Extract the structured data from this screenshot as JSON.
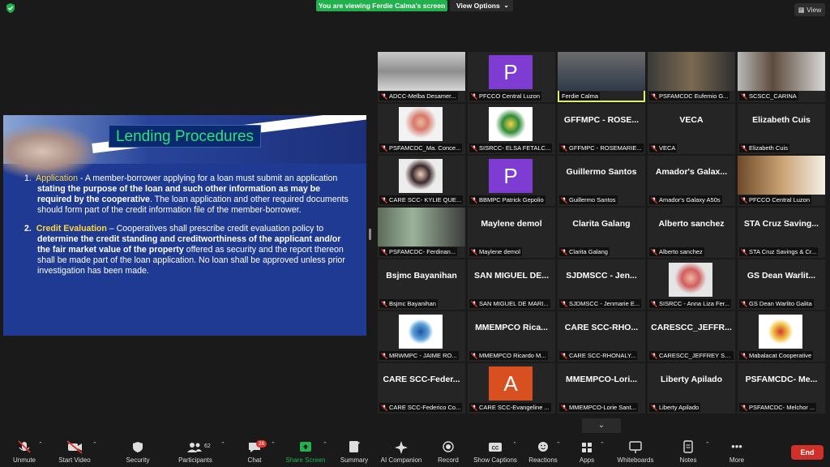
{
  "top": {
    "banner": "You are viewing Ferdie Calma's screen",
    "view_options": "View Options",
    "view": "View"
  },
  "slide": {
    "title": "Lending Procedures",
    "item1_num": "1.",
    "item1_kw": "Application",
    "item1_a": " - A member-borrower applying for a loan must submit an application ",
    "item1_b": "stating the purpose of the loan and such other information as may be required by the cooperative",
    "item1_c": ".  The loan application and other required documents should form part of the credit information file of the member-borrower.",
    "item2_num": "2.",
    "item2_kw": "Credit Evaluation",
    "item2_a": " – Cooperatives shall prescribe credit evaluation policy to ",
    "item2_b": "determine the credit standing and creditworthiness of the applicant and/or the fair market value of the property",
    "item2_c": " offered as security and the report thereon shall be made part of the loan application.  No loan shall be approved unless prior investigation has been made."
  },
  "tiles": [
    {
      "name": "ADCC-Melba Desamer...",
      "big": ""
    },
    {
      "name": "PFCCO Central Luzon",
      "big": "",
      "avatar": "P"
    },
    {
      "name": "Ferdie Calma",
      "big": ""
    },
    {
      "name": "PSFAMCDC Eufemio G...",
      "big": ""
    },
    {
      "name": "SCSCC_CARINA",
      "big": ""
    },
    {
      "name": "PSFAMCDC_Ma. Conce...",
      "big": ""
    },
    {
      "name": "SISRCC- ELSA FETALC...",
      "big": ""
    },
    {
      "name": "GFFMPC - ROSEMARIE...",
      "big": "GFFMPC - ROSE..."
    },
    {
      "name": "VECA",
      "big": "VECA"
    },
    {
      "name": "Elizabeth Cuis",
      "big": "Elizabeth Cuis"
    },
    {
      "name": "CARE SCC- KYLIE QUE...",
      "big": ""
    },
    {
      "name": "BBMPC Patrick Gepolio",
      "big": "",
      "avatar": "P"
    },
    {
      "name": "Guillermo Santos",
      "big": "Guillermo Santos"
    },
    {
      "name": "Amador's Galaxy A50s",
      "big": "Amador's Galax..."
    },
    {
      "name": "PFCCO Central Luzon",
      "big": ""
    },
    {
      "name": "PSFAMCDC- Ferdinan...",
      "big": ""
    },
    {
      "name": "Maylene demol",
      "big": "Maylene demol"
    },
    {
      "name": "Clarita Galang",
      "big": "Clarita Galang"
    },
    {
      "name": "Alberto sanchez",
      "big": "Alberto sanchez"
    },
    {
      "name": "STA Cruz Savings & Cr...",
      "big": "STA Cruz Saving..."
    },
    {
      "name": "Bsjmc Bayanihan",
      "big": "Bsjmc Bayanihan"
    },
    {
      "name": "SAN MIGUEL DE MARI...",
      "big": "SAN MIGUEL DE..."
    },
    {
      "name": "SJDMSCC - Jenmarie E...",
      "big": "SJDMSCC - Jen..."
    },
    {
      "name": "SISRCC - Anna Liza Fer...",
      "big": ""
    },
    {
      "name": "GS Dean Warlito Galita",
      "big": "GS Dean Warlit..."
    },
    {
      "name": "MRWMPC - JAIME RO...",
      "big": ""
    },
    {
      "name": "MMEMPCO Ricardo M...",
      "big": "MMEMPCO Rica..."
    },
    {
      "name": "CARE SCC-RHONALY...",
      "big": "CARE SCC-RHO..."
    },
    {
      "name": "CARESCC_JEFFREY SA...",
      "big": "CARESCC_JEFFR..."
    },
    {
      "name": "Mabalacat Cooperative",
      "big": ""
    },
    {
      "name": "CARE SCC-Federico Co...",
      "big": "CARE SCC-Feder..."
    },
    {
      "name": "CARE SCC-Evangeline ...",
      "big": "",
      "avatar": "A"
    },
    {
      "name": "MMEMPCO-Lorie Sant...",
      "big": "MMEMPCO-Lori..."
    },
    {
      "name": "Liberty Apilado",
      "big": "Liberty Apilado"
    },
    {
      "name": "PSFAMCDC- Melchor ...",
      "big": "PSFAMCDC- Me..."
    }
  ],
  "toolbar": {
    "unmute": "Unmute",
    "start_video": "Start Video",
    "security": "Security",
    "participants": "Participants",
    "participants_count": "62",
    "chat": "Chat",
    "chat_badge": "26",
    "share_screen": "Share Screen",
    "summary": "Summary",
    "ai_companion": "AI Companion",
    "record": "Record",
    "show_captions": "Show Captions",
    "reactions": "Reactions",
    "apps": "Apps",
    "whiteboards": "Whiteboards",
    "notes": "Notes",
    "more": "More",
    "end": "End"
  },
  "icons": [
    "shield-icon",
    "mic-muted-icon",
    "video-off-icon",
    "security-icon",
    "participants-icon",
    "chat-icon",
    "share-screen-icon",
    "summary-icon",
    "ai-companion-icon",
    "record-icon",
    "captions-icon",
    "reactions-icon",
    "apps-icon",
    "whiteboard-icon",
    "notes-icon",
    "more-icon",
    "chevron-down-icon"
  ],
  "colors": {
    "banner": "#23b14d",
    "active_border": "#e0f06a",
    "end": "#d0302a",
    "slide_bg": "#1f3a93",
    "keyword": "#ffd83b",
    "title": "#2ee07a"
  }
}
